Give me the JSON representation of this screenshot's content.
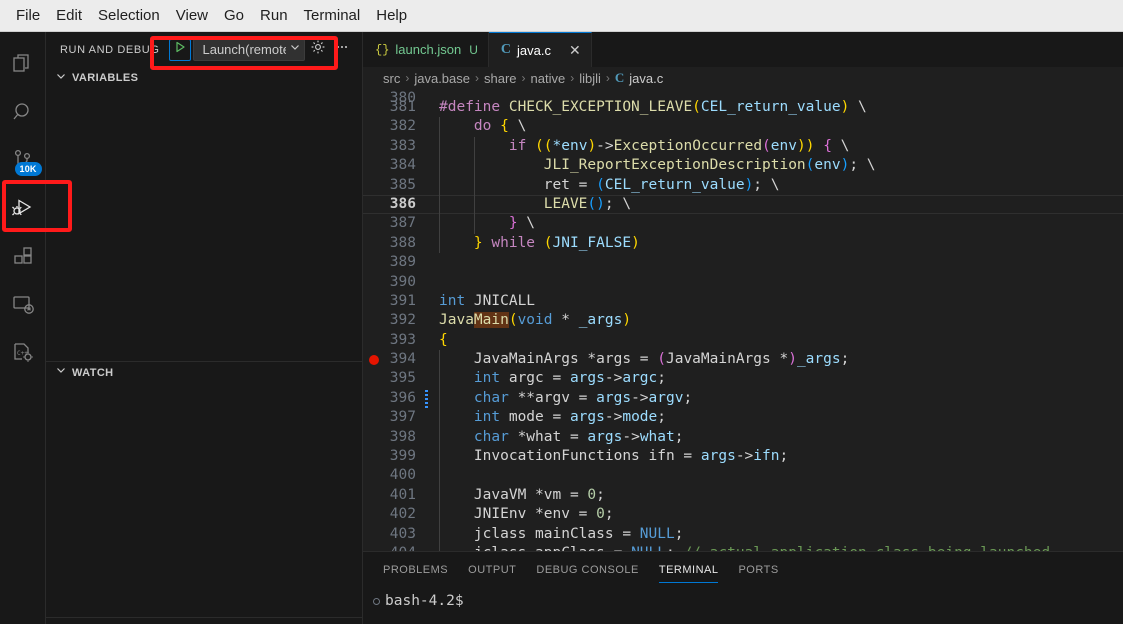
{
  "menubar": {
    "items": [
      {
        "label": "File"
      },
      {
        "label": "Edit"
      },
      {
        "label": "Selection"
      },
      {
        "label": "View"
      },
      {
        "label": "Go"
      },
      {
        "label": "Run"
      },
      {
        "label": "Terminal"
      },
      {
        "label": "Help"
      }
    ]
  },
  "activitybar": {
    "items": [
      {
        "name": "explorer",
        "icon": "files-icon",
        "active": false
      },
      {
        "name": "search",
        "icon": "search-icon",
        "active": false
      },
      {
        "name": "source-control",
        "icon": "source-control-icon",
        "active": false,
        "badge": "10K"
      },
      {
        "name": "run-and-debug",
        "icon": "run-debug-icon",
        "active": true
      },
      {
        "name": "extensions",
        "icon": "extensions-icon",
        "active": false
      },
      {
        "name": "remote-explorer",
        "icon": "remote-explorer-icon",
        "active": false
      },
      {
        "name": "cpp-tools",
        "icon": "cpp-gear-icon",
        "active": false
      }
    ]
  },
  "sidebar": {
    "title": "RUN AND DEBUG",
    "config": {
      "selected": "Launch(remote)",
      "start_icon": "play-icon",
      "dropdown_icon": "chevron-down-icon",
      "settings_icon": "gear-icon",
      "more_icon": "ellipsis-icon"
    },
    "sections": [
      {
        "label": "VARIABLES",
        "chevron": "chevron-down-icon"
      },
      {
        "label": "WATCH",
        "chevron": "chevron-down-icon"
      }
    ]
  },
  "editor": {
    "tabs": [
      {
        "label": "launch.json",
        "icon": "json-icon",
        "dirty": "U",
        "active": false
      },
      {
        "label": "java.c",
        "icon": "c-file-icon",
        "dirty": "",
        "active": true,
        "close_icon": "close-icon"
      }
    ],
    "breadcrumbs": [
      "src",
      "java.base",
      "share",
      "native",
      "libjli",
      "java.c"
    ],
    "breadcrumb_leaf_icon": "c-file-icon",
    "current_line": 386,
    "breakpoint_line": 394,
    "modified_line": 396,
    "lines": [
      {
        "n": 380,
        "indent": 0,
        "tokens": [],
        "clipped_top": true
      },
      {
        "n": 381,
        "indent": 0,
        "tokens": [
          {
            "t": "#define ",
            "c": "pp"
          },
          {
            "t": "CHECK_EXCEPTION_LEAVE",
            "c": "fn"
          },
          {
            "t": "(",
            "c": "br1"
          },
          {
            "t": "CEL_return_value",
            "c": "var"
          },
          {
            "t": ")",
            "c": "br1"
          },
          {
            "t": " \\",
            "c": "pl"
          }
        ]
      },
      {
        "n": 382,
        "indent": 1,
        "tokens": [
          {
            "t": "    do ",
            "c": "pp"
          },
          {
            "t": "{",
            "c": "br1"
          },
          {
            "t": " \\",
            "c": "pl"
          }
        ]
      },
      {
        "n": 383,
        "indent": 2,
        "tokens": [
          {
            "t": "        ",
            "c": "pl"
          },
          {
            "t": "if ",
            "c": "pp"
          },
          {
            "t": "((",
            "c": "br1"
          },
          {
            "t": "*env",
            "c": "var"
          },
          {
            "t": ")",
            "c": "br1"
          },
          {
            "t": "->",
            "c": "pl"
          },
          {
            "t": "ExceptionOccurred",
            "c": "fn"
          },
          {
            "t": "(",
            "c": "br2"
          },
          {
            "t": "env",
            "c": "var"
          },
          {
            "t": "))",
            "c": "br1"
          },
          {
            "t": " ",
            "c": "pl"
          },
          {
            "t": "{",
            "c": "br2"
          },
          {
            "t": " \\",
            "c": "pl"
          }
        ]
      },
      {
        "n": 384,
        "indent": 3,
        "tokens": [
          {
            "t": "            ",
            "c": "pl"
          },
          {
            "t": "JLI_ReportExceptionDescription",
            "c": "fn"
          },
          {
            "t": "(",
            "c": "br3"
          },
          {
            "t": "env",
            "c": "var"
          },
          {
            "t": ")",
            "c": "br3"
          },
          {
            "t": "; \\",
            "c": "pl"
          }
        ]
      },
      {
        "n": 385,
        "indent": 3,
        "tokens": [
          {
            "t": "            ret = ",
            "c": "pl"
          },
          {
            "t": "(",
            "c": "br3"
          },
          {
            "t": "CEL_return_value",
            "c": "var"
          },
          {
            "t": ")",
            "c": "br3"
          },
          {
            "t": "; \\",
            "c": "pl"
          }
        ]
      },
      {
        "n": 386,
        "indent": 3,
        "tokens": [
          {
            "t": "            ",
            "c": "pl"
          },
          {
            "t": "LEAVE",
            "c": "fn"
          },
          {
            "t": "()",
            "c": "br3"
          },
          {
            "t": "; \\",
            "c": "pl"
          }
        ]
      },
      {
        "n": 387,
        "indent": 2,
        "tokens": [
          {
            "t": "        ",
            "c": "pl"
          },
          {
            "t": "}",
            "c": "br2"
          },
          {
            "t": " \\",
            "c": "pl"
          }
        ]
      },
      {
        "n": 388,
        "indent": 1,
        "tokens": [
          {
            "t": "    ",
            "c": "pl"
          },
          {
            "t": "}",
            "c": "br1"
          },
          {
            "t": " ",
            "c": "pl"
          },
          {
            "t": "while ",
            "c": "pp"
          },
          {
            "t": "(",
            "c": "br1"
          },
          {
            "t": "JNI_FALSE",
            "c": "var"
          },
          {
            "t": ")",
            "c": "br1"
          }
        ]
      },
      {
        "n": 389,
        "indent": 0,
        "tokens": []
      },
      {
        "n": 390,
        "indent": 0,
        "tokens": []
      },
      {
        "n": 391,
        "indent": 0,
        "tokens": [
          {
            "t": "int ",
            "c": "kw"
          },
          {
            "t": "JNICALL",
            "c": "pl"
          }
        ]
      },
      {
        "n": 392,
        "indent": 0,
        "tokens": [
          {
            "t": "Java",
            "c": "fn"
          },
          {
            "t": "Main",
            "c": "fn hl"
          },
          {
            "t": "(",
            "c": "br1"
          },
          {
            "t": "void",
            "c": "kw"
          },
          {
            "t": " * ",
            "c": "pl"
          },
          {
            "t": "_args",
            "c": "var"
          },
          {
            "t": ")",
            "c": "br1"
          }
        ]
      },
      {
        "n": 393,
        "indent": 0,
        "tokens": [
          {
            "t": "{",
            "c": "br1"
          }
        ]
      },
      {
        "n": 394,
        "indent": 1,
        "tokens": [
          {
            "t": "    JavaMainArgs *args = ",
            "c": "pl"
          },
          {
            "t": "(",
            "c": "br2"
          },
          {
            "t": "JavaMainArgs *",
            "c": "pl"
          },
          {
            "t": ")",
            "c": "br2"
          },
          {
            "t": "_args",
            "c": "var"
          },
          {
            "t": ";",
            "c": "pl"
          }
        ]
      },
      {
        "n": 395,
        "indent": 1,
        "tokens": [
          {
            "t": "    ",
            "c": "pl"
          },
          {
            "t": "int ",
            "c": "kw"
          },
          {
            "t": "argc = ",
            "c": "pl"
          },
          {
            "t": "args",
            "c": "var"
          },
          {
            "t": "->",
            "c": "pl"
          },
          {
            "t": "argc",
            "c": "var"
          },
          {
            "t": ";",
            "c": "pl"
          }
        ]
      },
      {
        "n": 396,
        "indent": 1,
        "tokens": [
          {
            "t": "    ",
            "c": "pl"
          },
          {
            "t": "char ",
            "c": "kw"
          },
          {
            "t": "**argv = ",
            "c": "pl"
          },
          {
            "t": "args",
            "c": "var"
          },
          {
            "t": "->",
            "c": "pl"
          },
          {
            "t": "argv",
            "c": "var"
          },
          {
            "t": ";",
            "c": "pl"
          }
        ]
      },
      {
        "n": 397,
        "indent": 1,
        "tokens": [
          {
            "t": "    ",
            "c": "pl"
          },
          {
            "t": "int ",
            "c": "kw"
          },
          {
            "t": "mode = ",
            "c": "pl"
          },
          {
            "t": "args",
            "c": "var"
          },
          {
            "t": "->",
            "c": "pl"
          },
          {
            "t": "mode",
            "c": "var"
          },
          {
            "t": ";",
            "c": "pl"
          }
        ]
      },
      {
        "n": 398,
        "indent": 1,
        "tokens": [
          {
            "t": "    ",
            "c": "pl"
          },
          {
            "t": "char ",
            "c": "kw"
          },
          {
            "t": "*what = ",
            "c": "pl"
          },
          {
            "t": "args",
            "c": "var"
          },
          {
            "t": "->",
            "c": "pl"
          },
          {
            "t": "what",
            "c": "var"
          },
          {
            "t": ";",
            "c": "pl"
          }
        ]
      },
      {
        "n": 399,
        "indent": 1,
        "tokens": [
          {
            "t": "    InvocationFunctions ifn = ",
            "c": "pl"
          },
          {
            "t": "args",
            "c": "var"
          },
          {
            "t": "->",
            "c": "pl"
          },
          {
            "t": "ifn",
            "c": "var"
          },
          {
            "t": ";",
            "c": "pl"
          }
        ]
      },
      {
        "n": 400,
        "indent": 1,
        "tokens": []
      },
      {
        "n": 401,
        "indent": 1,
        "tokens": [
          {
            "t": "    JavaVM *vm = ",
            "c": "pl"
          },
          {
            "t": "0",
            "c": "num"
          },
          {
            "t": ";",
            "c": "pl"
          }
        ]
      },
      {
        "n": 402,
        "indent": 1,
        "tokens": [
          {
            "t": "    JNIEnv *env = ",
            "c": "pl"
          },
          {
            "t": "0",
            "c": "num"
          },
          {
            "t": ";",
            "c": "pl"
          }
        ]
      },
      {
        "n": 403,
        "indent": 1,
        "tokens": [
          {
            "t": "    jclass mainClass = ",
            "c": "pl"
          },
          {
            "t": "NULL",
            "c": "cnst"
          },
          {
            "t": ";",
            "c": "pl"
          }
        ]
      },
      {
        "n": 404,
        "indent": 1,
        "tokens": [
          {
            "t": "    jclass appClass = ",
            "c": "pl"
          },
          {
            "t": "NULL",
            "c": "cnst"
          },
          {
            "t": "; ",
            "c": "pl"
          },
          {
            "t": "// actual application class being launched",
            "c": "cmt"
          }
        ]
      }
    ]
  },
  "panel": {
    "tabs": [
      {
        "label": "PROBLEMS",
        "active": false
      },
      {
        "label": "OUTPUT",
        "active": false
      },
      {
        "label": "DEBUG CONSOLE",
        "active": false
      },
      {
        "label": "TERMINAL",
        "active": true
      },
      {
        "label": "PORTS",
        "active": false
      }
    ],
    "terminal_prompt": "bash-4.2$"
  },
  "annotations": [
    {
      "name": "config-highlight",
      "color": "#ff1a1a"
    },
    {
      "name": "activity-run-debug-highlight",
      "color": "#ff1a1a"
    }
  ]
}
